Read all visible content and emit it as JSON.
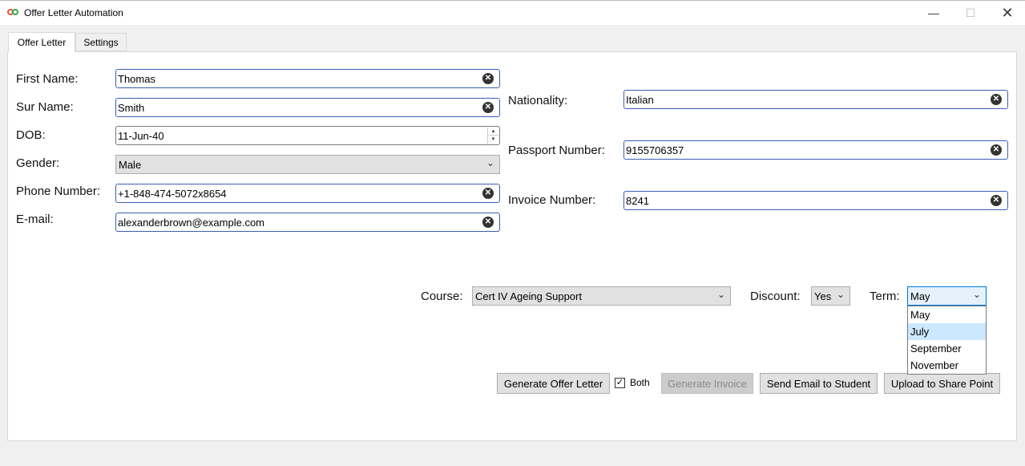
{
  "window": {
    "title": "Offer Letter Automation",
    "minimize": "—",
    "maximize": "☐",
    "close": "✕"
  },
  "tabs": [
    {
      "label": "Offer Letter",
      "active": true
    },
    {
      "label": "Settings",
      "active": false
    }
  ],
  "form": {
    "first_name": {
      "label": "First Name:",
      "value": "Thomas"
    },
    "sur_name": {
      "label": "Sur Name:",
      "value": "Smith"
    },
    "dob": {
      "label": "DOB:",
      "value": "11-Jun-40"
    },
    "gender": {
      "label": "Gender:",
      "value": "Male"
    },
    "phone": {
      "label": "Phone Number:",
      "value": "+1-848-474-5072x8654"
    },
    "email": {
      "label": "E-mail:",
      "value": "alexanderbrown@example.com"
    },
    "nationality": {
      "label": "Nationality:",
      "value": "Italian"
    },
    "passport": {
      "label": "Passport Number:",
      "value": "9155706357"
    },
    "invoice": {
      "label": "Invoice Number:",
      "value": "8241"
    }
  },
  "course": {
    "label": "Course:",
    "value": "Cert IV Ageing Support"
  },
  "discount": {
    "label": "Discount:",
    "value": "Yes"
  },
  "term": {
    "label": "Term:",
    "value": "May",
    "options": [
      "May",
      "July",
      "September",
      "November"
    ],
    "highlighted": "July"
  },
  "actions": {
    "generate_offer": "Generate Offer Letter",
    "both_label": "Both",
    "both_checked": true,
    "generate_invoice": "Generate Invoice",
    "send_email": "Send Email to Student",
    "upload": "Upload to Share Point"
  },
  "icons": {
    "clear": "clear-icon",
    "chevron": "chevron-down-icon",
    "app": "app-logo-icon"
  },
  "colors": {
    "focus_border": "#3a5fb7",
    "highlight": "#cce8ff"
  }
}
